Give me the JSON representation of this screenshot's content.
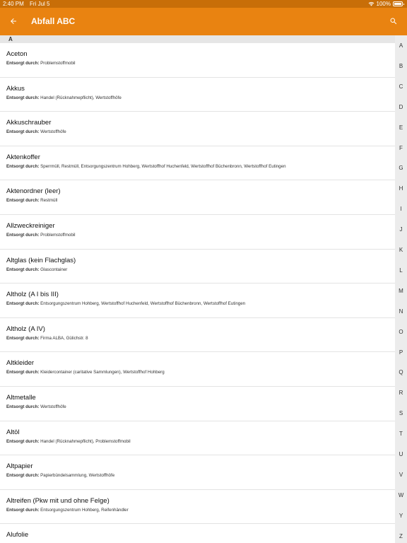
{
  "status_bar": {
    "time": "2:40 PM",
    "date": "Fri Jul 5",
    "battery": "100%"
  },
  "app_bar": {
    "title": "Abfall ABC"
  },
  "section": {
    "letter": "A"
  },
  "detail_label": "Entsorgt durch:",
  "items": [
    {
      "title": "Aceton",
      "detail": "Problemstoffmobil"
    },
    {
      "title": "Akkus",
      "detail": "Handel (Rücknahmepflicht), Wertstoffhöfe"
    },
    {
      "title": "Akkuschrauber",
      "detail": "Wertstoffhöfe"
    },
    {
      "title": "Aktenkoffer",
      "detail": "Sperrmüll, Restmüll, Entsorgungszentrum Hohberg, Wertstoffhof Huchenfeld, Wertstoffhof Büchenbronn, Wertstoffhof Eutingen"
    },
    {
      "title": "Aktenordner (leer)",
      "detail": "Restmüll"
    },
    {
      "title": "Allzweckreiniger",
      "detail": "Problemstoffmobil"
    },
    {
      "title": "Altglas (kein Flachglas)",
      "detail": "Glascontainer"
    },
    {
      "title": "Altholz (A I bis III)",
      "detail": "Entsorgungszentrum Hohberg, Wertstoffhof Huchenfeld, Wertstoffhof Büchenbronn, Wertstoffhof Eutingen"
    },
    {
      "title": "Altholz (A IV)",
      "detail": "Firma ALBA, Gülichstr. 8"
    },
    {
      "title": "Altkleider",
      "detail": "Kleidercontainer (caritative Sammlungen), Wertstoffhof Hohberg"
    },
    {
      "title": "Altmetalle",
      "detail": "Wertstoffhöfe"
    },
    {
      "title": "Altöl",
      "detail": "Handel (Rücknahmepflicht), Problemstoffmobil"
    },
    {
      "title": "Altpapier",
      "detail": "Papierbündelsammlung, Wertstoffhöfe"
    },
    {
      "title": "Altreifen (Pkw mit und ohne Felge)",
      "detail": "Entsorgungszentrum Hohberg, Reifenhändler"
    },
    {
      "title": "Alufolie",
      "detail": ""
    }
  ],
  "index_letters": [
    "A",
    "B",
    "C",
    "D",
    "E",
    "F",
    "G",
    "H",
    "I",
    "J",
    "K",
    "L",
    "M",
    "N",
    "O",
    "P",
    "Q",
    "R",
    "S",
    "T",
    "U",
    "V",
    "W",
    "Y",
    "Z"
  ],
  "colors": {
    "app_bar": "#e98311",
    "status_bar": "#c86e08"
  },
  "icons": {
    "back": "arrow-left-icon",
    "search": "search-icon"
  }
}
